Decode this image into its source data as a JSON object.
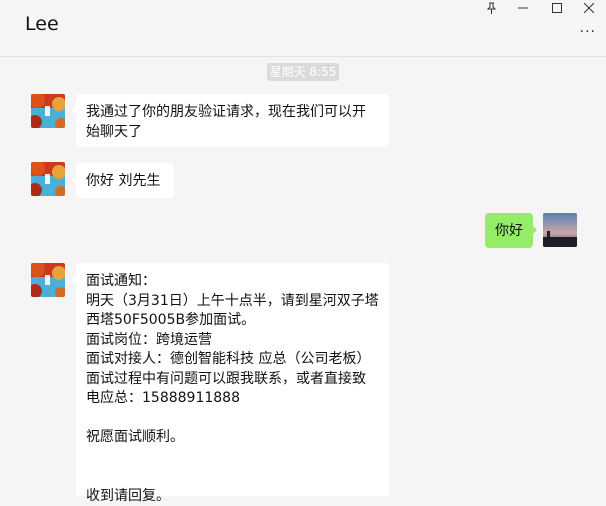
{
  "window": {
    "title": "Lee",
    "controls": {
      "pin": "⊥",
      "minimize": "—",
      "maximize": "☐",
      "close": "✕"
    },
    "more": "···"
  },
  "chat": {
    "timestamp": "星期天 8:55",
    "messages": [
      {
        "from": "contact",
        "text": "我通过了你的朋友验证请求，现在我们可以开始聊天了"
      },
      {
        "from": "contact",
        "text": "你好  刘先生"
      },
      {
        "from": "me",
        "text": "你好"
      },
      {
        "from": "contact",
        "text": "面试通知：\n明天（3月31日）上午十点半，请到星河双子塔西塔50F5005B参加面试。\n面试岗位：跨境运营\n面试对接人：德创智能科技 应总（公司老板）\n面试过程中有问题可以跟我联系，或者直接致电应总：15888911888\n\n祝愿面试顺利。\n\n\n收到请回复。"
      }
    ]
  },
  "colors": {
    "my_bubble": "#95ec69",
    "contact_bubble": "#ffffff",
    "background": "#f5f5f5"
  }
}
